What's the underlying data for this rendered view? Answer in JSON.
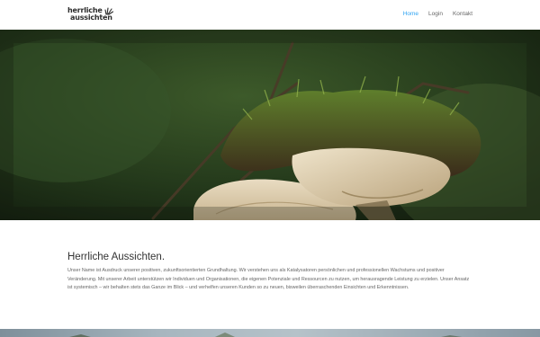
{
  "brand": {
    "line1": "herrliche",
    "line2": "aussichten",
    "mark_icon": "sun-rays-icon"
  },
  "nav": {
    "items": [
      {
        "label": "Home",
        "active": true
      },
      {
        "label": "Login",
        "active": false
      },
      {
        "label": "Kontakt",
        "active": false
      }
    ]
  },
  "slider": {
    "slide_count": 5,
    "active_slide": 1,
    "image": "mushroom-moss-photo"
  },
  "intro": {
    "heading": "Herrliche Aussichten.",
    "body": "Unser Name ist Ausdruck unserer positiven, zukunftsorientierten Grundhaltung. Wir verstehen uns als Katalysatoren persönlichen und professionellen Wachstums und positiver Veränderung. Mit unserer Arbeit unterstützen wir Individuen und Organisationen, die eigenen Potenziale und Ressourcen zu nutzen, um herausragende Leistung zu erzielen. Unser Ansatz ist systemisch – wir behalten stets das Ganze im Blick – und verhelfen unseren Kunden so zu neuen, bisweilen überraschenden Einsichten und Erkenntnissen."
  },
  "colors": {
    "accent": "#2ea3f2",
    "text": "#666666",
    "heading": "#333333"
  }
}
